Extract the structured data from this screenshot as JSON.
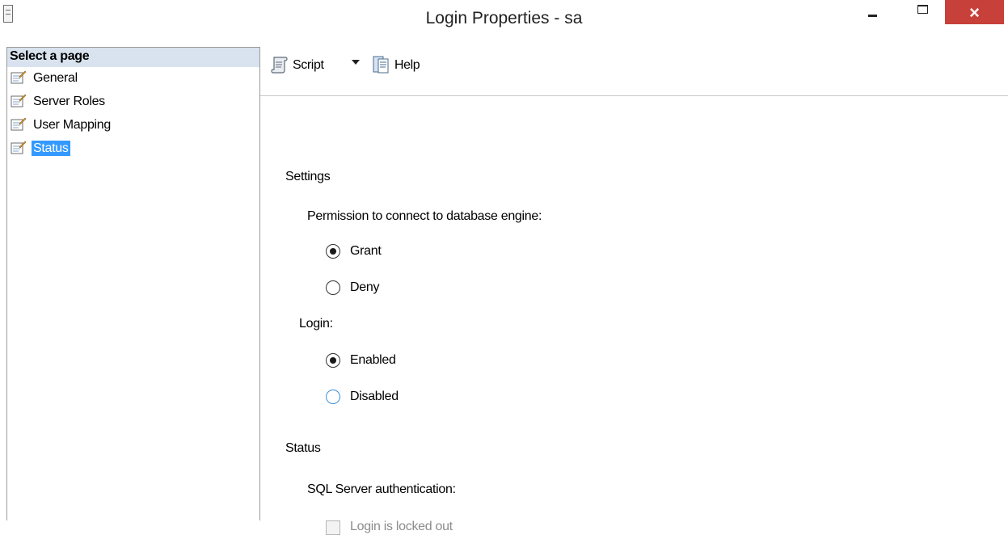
{
  "window": {
    "title": "Login Properties - sa",
    "close_glyph": "×"
  },
  "left_pane": {
    "header": "Select a page",
    "items": [
      {
        "label": "General",
        "selected": false
      },
      {
        "label": "Server Roles",
        "selected": false
      },
      {
        "label": "User Mapping",
        "selected": false
      },
      {
        "label": "Status",
        "selected": true
      }
    ]
  },
  "toolbar": {
    "script_label": "Script",
    "help_label": "Help"
  },
  "settings": {
    "section_title": "Settings",
    "permission_label": "Permission to connect to database engine:",
    "permission_options": [
      {
        "label": "Grant",
        "checked": true
      },
      {
        "label": "Deny",
        "checked": false
      }
    ],
    "login_label": "Login:",
    "login_options": [
      {
        "label": "Enabled",
        "checked": true
      },
      {
        "label": "Disabled",
        "checked": false
      }
    ]
  },
  "status": {
    "section_title": "Status",
    "auth_label": "SQL Server authentication:",
    "locked_out_label": "Login is locked out",
    "locked_out_checked": false,
    "locked_out_enabled": false
  },
  "colors": {
    "selection": "#3399ff",
    "header_bg": "#d9e3ef",
    "close_button": "#c7403a",
    "focus_ring": "#3c8fd8"
  },
  "icons": {
    "app": "server-document-icon",
    "page": "property-page-icon",
    "script": "script-scroll-icon",
    "help": "help-book-icon"
  }
}
